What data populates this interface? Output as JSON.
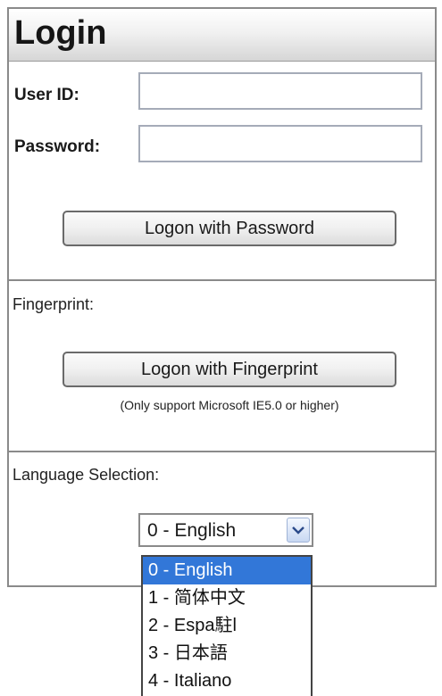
{
  "header": {
    "title": "Login"
  },
  "login_form": {
    "user_id_label": "User ID:",
    "user_id_value": "",
    "password_label": "Password:",
    "password_value": "",
    "password_button": "Logon with Password"
  },
  "fingerprint": {
    "section_label": "Fingerprint:",
    "button": "Logon with Fingerprint",
    "note": "(Only support Microsoft IE5.0 or higher)"
  },
  "language": {
    "section_label": "Language Selection:",
    "selected": "0 - English",
    "options": [
      "0 - English",
      "1 - 简体中文",
      "2 - Espa駐l",
      "3 - 日本語",
      "4 - Italiano"
    ],
    "highlighted_index": 0
  },
  "icons": {
    "dropdown_arrow": "chevron-down-icon"
  },
  "colors": {
    "highlight": "#3277d8",
    "border": "#8a8a8a",
    "input_border": "#a5abb8"
  }
}
